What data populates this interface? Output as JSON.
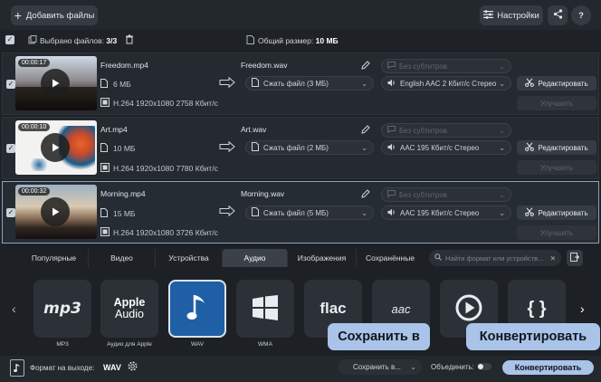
{
  "toolbar": {
    "add_files_label": "Добавить файлы",
    "settings_label": "Настройки",
    "share_icon": "share-icon",
    "help_label": "?"
  },
  "files_header": {
    "selected_label": "Выбрано файлов:",
    "selected_count": "3/3",
    "total_size_label": "Общий размер:",
    "total_size": "10 МБ"
  },
  "files": [
    {
      "duration": "00:00:17",
      "name": "Freedom.mp4",
      "size": "6 МБ",
      "resolution": "1920x1080",
      "codec_info": "H.264 1920x1080 2758 Кбит/с",
      "output_name": "Freedom.wav",
      "compress": "Сжать файл (3 МБ)",
      "audio": "English AAC 2 Кбит/с Стерео",
      "subtitles": "Без субтитров",
      "edit_label": "Редактировать",
      "improve_label": "Улучшить"
    },
    {
      "duration": "00:00:10",
      "name": "Art.mp4",
      "size": "10 МБ",
      "resolution": "1920x1080",
      "codec_info": "H.264 1920x1080 7780 Кбит/с",
      "output_name": "Art.wav",
      "compress": "Сжать файл (2 МБ)",
      "audio": "AAC 195 Кбит/с Стерео",
      "subtitles": "Без субтитров",
      "edit_label": "Редактировать",
      "improve_label": "Улучшить"
    },
    {
      "duration": "00:00:32",
      "name": "Morning.mp4",
      "size": "15 МБ",
      "resolution": "1920x1080",
      "codec_info": "H.264 1920x1080 3726 Кбит/с",
      "output_name": "Morning.wav",
      "compress": "Сжать файл (5 МБ)",
      "audio": "AAC 195 Кбит/с Стерео",
      "subtitles": "Без субтитров",
      "edit_label": "Редактировать",
      "improve_label": "Улучшить"
    }
  ],
  "format_tabs": [
    {
      "label": "Популярные"
    },
    {
      "label": "Видео"
    },
    {
      "label": "Устройства"
    },
    {
      "label": "Аудио",
      "active": true
    },
    {
      "label": "Изображения"
    },
    {
      "label": "Сохранённые"
    }
  ],
  "format_search": {
    "placeholder": "Найти формат или устройств..."
  },
  "formats": [
    {
      "label": "MP3",
      "logo": "mp3"
    },
    {
      "label": "Аудио для Apple",
      "logo_line1": "Apple",
      "logo_line2": "Audio"
    },
    {
      "label": "WAV",
      "active": true
    },
    {
      "label": "WMA"
    },
    {
      "label": "",
      "logo": "flac"
    },
    {
      "label": "",
      "logo": "aac"
    },
    {
      "label": ""
    },
    {
      "label": "",
      "logo": "{ }"
    }
  ],
  "bottom": {
    "output_format_label": "Формат на выходе:",
    "output_format_value": "WAV",
    "save_to_value": "Сохранить в...",
    "merge_label": "Объединить:",
    "convert_label": "Конвертировать"
  },
  "tooltips": {
    "save_to": "Сохранить в",
    "convert": "Конвертировать"
  },
  "colors": {
    "accent": "#a9c3e9",
    "active_tile": "#1f5fa6",
    "background": "#1e2226"
  }
}
